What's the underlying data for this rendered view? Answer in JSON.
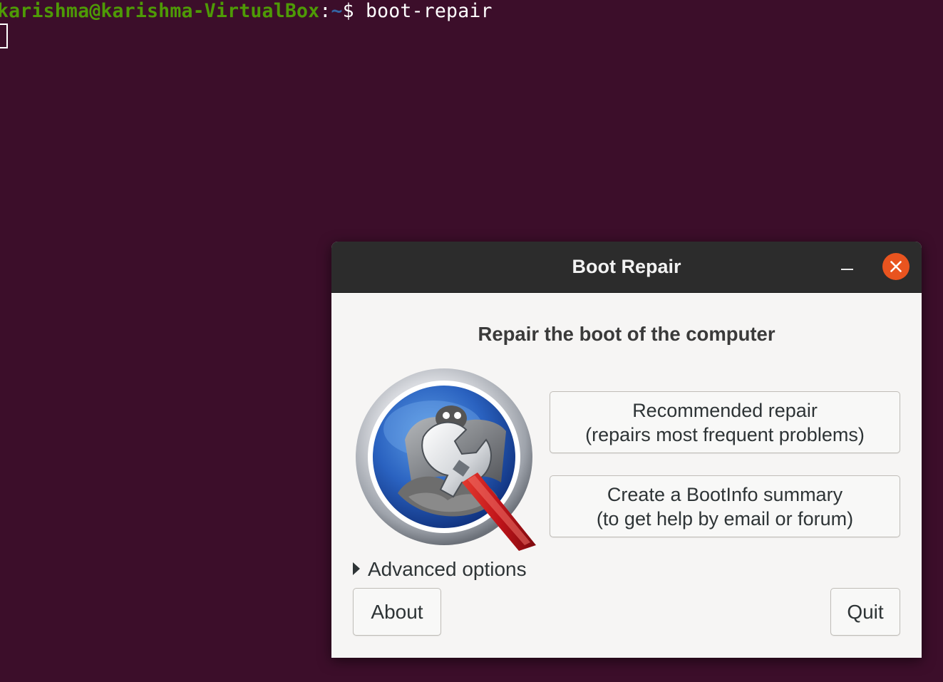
{
  "terminal": {
    "user_host": "karishma@karishma-VirtualBox",
    "colon": ":",
    "path": "~",
    "dollar": "$ ",
    "command": "boot-repair"
  },
  "window": {
    "title": "Boot Repair",
    "heading": "Repair the boot of the computer",
    "recommended_repair": {
      "line1": "Recommended repair",
      "line2": "(repairs most frequent problems)"
    },
    "bootinfo_summary": {
      "line1": "Create a BootInfo summary",
      "line2": "(to get help by email or forum)"
    },
    "advanced_options_label": "Advanced options",
    "about_label": "About",
    "quit_label": "Quit"
  },
  "colors": {
    "terminal_background": "#3c0e2a",
    "prompt_user": "#4e9a06",
    "prompt_path": "#3465a4",
    "titlebar": "#2c2c2c",
    "close_button": "#e9541f",
    "dialog_background": "#f6f5f4"
  },
  "icons": {
    "app_logo": "boot-repair-logo-icon",
    "minimize": "minimize-icon",
    "close": "close-icon",
    "expander": "triangle-right-icon"
  }
}
